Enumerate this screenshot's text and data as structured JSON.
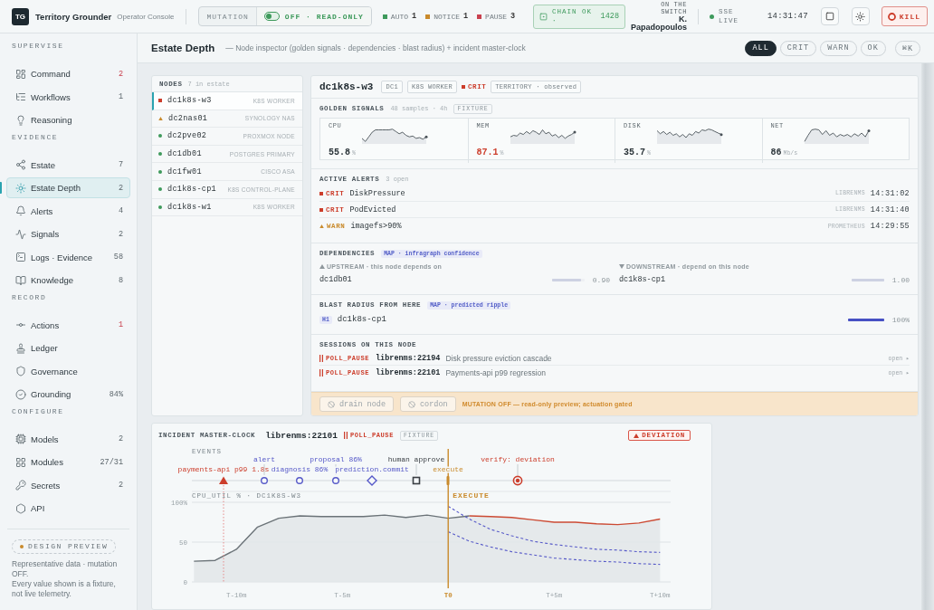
{
  "topbar": {
    "logo": "TG",
    "title": "Territory Grounder",
    "subtitle": "Operator Console",
    "mutation": {
      "label": "MUTATION",
      "on": false,
      "status": "OFF · READ-ONLY"
    },
    "counters": [
      {
        "label": "AUTO",
        "count": "1",
        "color": "#3e9a5c"
      },
      {
        "label": "NOTICE",
        "count": "1",
        "color": "#c98a2b"
      },
      {
        "label": "PAUSE",
        "count": "3",
        "color": "#c9414f"
      }
    ],
    "chain": {
      "label": "CHAIN OK ·",
      "count": "1428"
    },
    "operator": {
      "caption": "ON THE SWITCH",
      "name": "K. Papadopoulos"
    },
    "stream": {
      "label": "SSE LIVE",
      "live": true
    },
    "clock": "14:31:47",
    "kill": "KILL"
  },
  "sidebar": {
    "sections": [
      {
        "title": "SUPERVISE",
        "items": [
          {
            "label": "Command",
            "count": "2",
            "urgent": true,
            "selected": false
          },
          {
            "label": "Workflows",
            "count": "1",
            "urgent": false,
            "selected": false
          },
          {
            "label": "Reasoning",
            "selected": false
          }
        ]
      },
      {
        "title": "EVIDENCE",
        "items": [
          {
            "label": "Estate",
            "count": "7",
            "urgent": false,
            "selected": false
          },
          {
            "label": "Estate Depth",
            "count": "2",
            "urgent": false,
            "selected": true
          },
          {
            "label": "Alerts",
            "count": "4",
            "urgent": false,
            "selected": false
          },
          {
            "label": "Signals",
            "count": "2",
            "urgent": false,
            "selected": false
          },
          {
            "label": "Logs · Evidence",
            "count": "58",
            "urgent": false,
            "selected": false
          },
          {
            "label": "Knowledge",
            "count": "8",
            "urgent": false,
            "selected": false
          }
        ]
      },
      {
        "title": "RECORD",
        "items": [
          {
            "label": "Actions",
            "count": "1",
            "urgent": true,
            "selected": false
          },
          {
            "label": "Ledger",
            "selected": false
          },
          {
            "label": "Governance",
            "selected": false
          },
          {
            "label": "Grounding",
            "count": "84%",
            "urgent": false,
            "selected": false
          }
        ]
      },
      {
        "title": "CONFIGURE",
        "items": [
          {
            "label": "Models",
            "count": "2",
            "urgent": false,
            "selected": false
          },
          {
            "label": "Modules",
            "count": "27/31",
            "urgent": false,
            "selected": false
          },
          {
            "label": "Secrets",
            "count": "2",
            "urgent": false,
            "selected": false
          },
          {
            "label": "API",
            "selected": false
          }
        ]
      }
    ],
    "preview": {
      "badge": "DESIGN PREVIEW",
      "notes": [
        "Representative data · mutation OFF.",
        "Every value shown is a fixture, not live telemetry."
      ]
    }
  },
  "page": {
    "title": "Estate Depth",
    "subtitle": "— Node inspector (golden signals · dependencies · blast radius) + incident master-clock",
    "filters": [
      {
        "label": "ALL",
        "selected": true
      },
      {
        "label": "CRIT",
        "selected": false
      },
      {
        "label": "WARN",
        "selected": false
      },
      {
        "label": "OK",
        "selected": false
      }
    ],
    "shortcut": "⌘K"
  },
  "nodes": {
    "title": "NODES",
    "count": "7 in estate",
    "items": [
      {
        "name": "dc1k8s-w3",
        "type": "K8S WORKER",
        "kind": "crit",
        "selected": true
      },
      {
        "name": "dc2nas01",
        "type": "SYNOLOGY NAS",
        "kind": "warn",
        "selected": false
      },
      {
        "name": "dc2pve02",
        "type": "PROXMOX NODE",
        "kind": "ok",
        "selected": false
      },
      {
        "name": "dc1db01",
        "type": "POSTGRES PRIMARY",
        "kind": "ok",
        "selected": false
      },
      {
        "name": "dc1fw01",
        "type": "CISCO ASA",
        "kind": "ok",
        "selected": false
      },
      {
        "name": "dc1k8s-cp1",
        "type": "K8S CONTROL-PLANE",
        "kind": "ok",
        "selected": false
      },
      {
        "name": "dc1k8s-w1",
        "type": "K8S WORKER",
        "kind": "ok",
        "selected": false
      }
    ]
  },
  "detail": {
    "name": "dc1k8s-w3",
    "tags": [
      "DC1",
      "K8S WORKER"
    ],
    "severity": {
      "kind": "crit",
      "label": "CRIT"
    },
    "territory": "TERRITORY · observed",
    "signals": {
      "title": "GOLDEN SIGNALS",
      "meta": "48 samples · 4h",
      "badge": "FIXTURE",
      "metrics": [
        {
          "label": "CPU",
          "value": "55.8",
          "unit": "%",
          "alert": false
        },
        {
          "label": "MEM",
          "value": "87.1",
          "unit": "%",
          "alert": true
        },
        {
          "label": "DISK",
          "value": "35.7",
          "unit": "%",
          "alert": false
        },
        {
          "label": "NET",
          "value": "86",
          "unit": "Mb/s",
          "alert": false
        }
      ]
    },
    "alerts": {
      "title": "ACTIVE ALERTS",
      "meta": "3 open",
      "items": [
        {
          "kind": "crit",
          "severity": "CRIT",
          "name": "DiskPressure",
          "source": "LIBRENMS",
          "time": "14:31:02"
        },
        {
          "kind": "crit",
          "severity": "CRIT",
          "name": "PodEvicted",
          "source": "LIBRENMS",
          "time": "14:31:40"
        },
        {
          "kind": "warn",
          "severity": "WARN",
          "name": "imagefs>90%",
          "source": "PROMETHEUS",
          "time": "14:29:55"
        }
      ]
    },
    "dependencies": {
      "title": "DEPENDENCIES",
      "tag": "MAP · infragraph confidence",
      "groups": [
        {
          "kind": "up",
          "heading": "UPSTREAM · this node depends on",
          "items": [
            {
              "name": "dc1db01",
              "level": 0.9,
              "score": "0.90"
            }
          ]
        },
        {
          "kind": "down",
          "heading": "DOWNSTREAM · depend on this node",
          "items": [
            {
              "name": "dc1k8s-cp1",
              "level": 1.0,
              "score": "1.00"
            }
          ]
        }
      ]
    },
    "blast": {
      "title": "BLAST RADIUS FROM HERE",
      "tag": "MAP · predicted ripple",
      "items": [
        {
          "hop": "H1",
          "name": "dc1k8s-cp1",
          "level": 1.0,
          "share": "100%"
        }
      ]
    },
    "sessions": {
      "title": "SESSIONS ON THIS NODE",
      "items": [
        {
          "state": "POLL_PAUSE",
          "id": "librenms:22194",
          "summary": "Disk pressure eviction cascade",
          "link": "open ▸"
        },
        {
          "state": "POLL_PAUSE",
          "id": "librenms:22101",
          "summary": "Payments-api p99 regression",
          "link": "open ▸"
        }
      ]
    },
    "actions": {
      "buttons": [
        {
          "label": "drain node",
          "disabled": true
        },
        {
          "label": "cordon",
          "disabled": true
        }
      ],
      "notice": "MUTATION OFF — read-only preview; actuation gated"
    }
  },
  "chart": {
    "title": "INCIDENT MASTER-CLOCK",
    "session": "librenms:22101",
    "state": "POLL_PAUSE",
    "badge": "FIXTURE",
    "flag": "DEVIATION",
    "events_label": "EVENTS",
    "events": [
      {
        "kind": "triangle",
        "color": "#cc3d2b"
      },
      {
        "kind": "circle",
        "color": "#5558c8"
      },
      {
        "kind": "circle",
        "color": "#5558c8"
      },
      {
        "kind": "circle",
        "color": "#5558c8"
      },
      {
        "kind": "diamond",
        "color": "#5558c8"
      },
      {
        "kind": "square",
        "color": "#3a3f44"
      },
      {
        "kind": "tick",
        "color": "#c98a2b"
      },
      {
        "kind": "target",
        "color": "#cc3d2b"
      }
    ],
    "chart_data": {
      "type": "line",
      "title": "CPU_UTIL % · DC1K8S-W3",
      "categories": [
        null,
        null,
        "T-10m",
        null,
        null,
        null,
        null,
        "T-5m",
        null,
        null,
        null,
        null,
        "T0",
        null,
        null,
        null,
        null,
        "T+5m",
        null,
        null,
        null,
        null,
        "T+10m"
      ],
      "ylim": [
        0,
        100
      ],
      "yticks": [
        {
          "value": 0,
          "label": "0"
        },
        {
          "value": 50,
          "label": "50"
        },
        {
          "value": 100,
          "label": "100%"
        }
      ],
      "series": [
        {
          "color": "#6b7378",
          "line_style": "solid",
          "values": [
            26,
            27,
            41,
            69,
            80,
            83,
            82,
            82,
            82,
            84,
            81,
            84,
            80,
            83,
            null,
            null,
            null,
            null,
            null,
            null,
            null,
            null,
            null
          ]
        },
        {
          "color": "#cc4a33",
          "line_style": "solid",
          "values": [
            null,
            null,
            null,
            null,
            null,
            null,
            null,
            null,
            null,
            null,
            null,
            null,
            null,
            83,
            82,
            81,
            78,
            75,
            75,
            73,
            72,
            74,
            79
          ]
        },
        {
          "color": "#5558c8",
          "line_style": "dashed",
          "values": [
            null,
            null,
            null,
            null,
            null,
            null,
            null,
            null,
            null,
            null,
            null,
            null,
            95,
            79,
            66,
            58,
            51,
            47,
            44,
            41,
            40,
            38,
            37
          ]
        },
        {
          "color": "#5558c8",
          "line_style": "dashed",
          "values": [
            null,
            null,
            null,
            null,
            null,
            null,
            null,
            null,
            null,
            null,
            null,
            null,
            63,
            51,
            44,
            38,
            34,
            30,
            28,
            26,
            25,
            23,
            22
          ]
        }
      ],
      "ref_lines": [
        {
          "axis": "y",
          "value": 50
        }
      ],
      "annotations": [
        "payments-api p99 1.8s",
        "alert",
        "diagnosis 86%",
        "proposal 86%",
        "prediction.commit",
        "human approve",
        "execute",
        "verify: deviation",
        "EXECUTE"
      ]
    }
  }
}
